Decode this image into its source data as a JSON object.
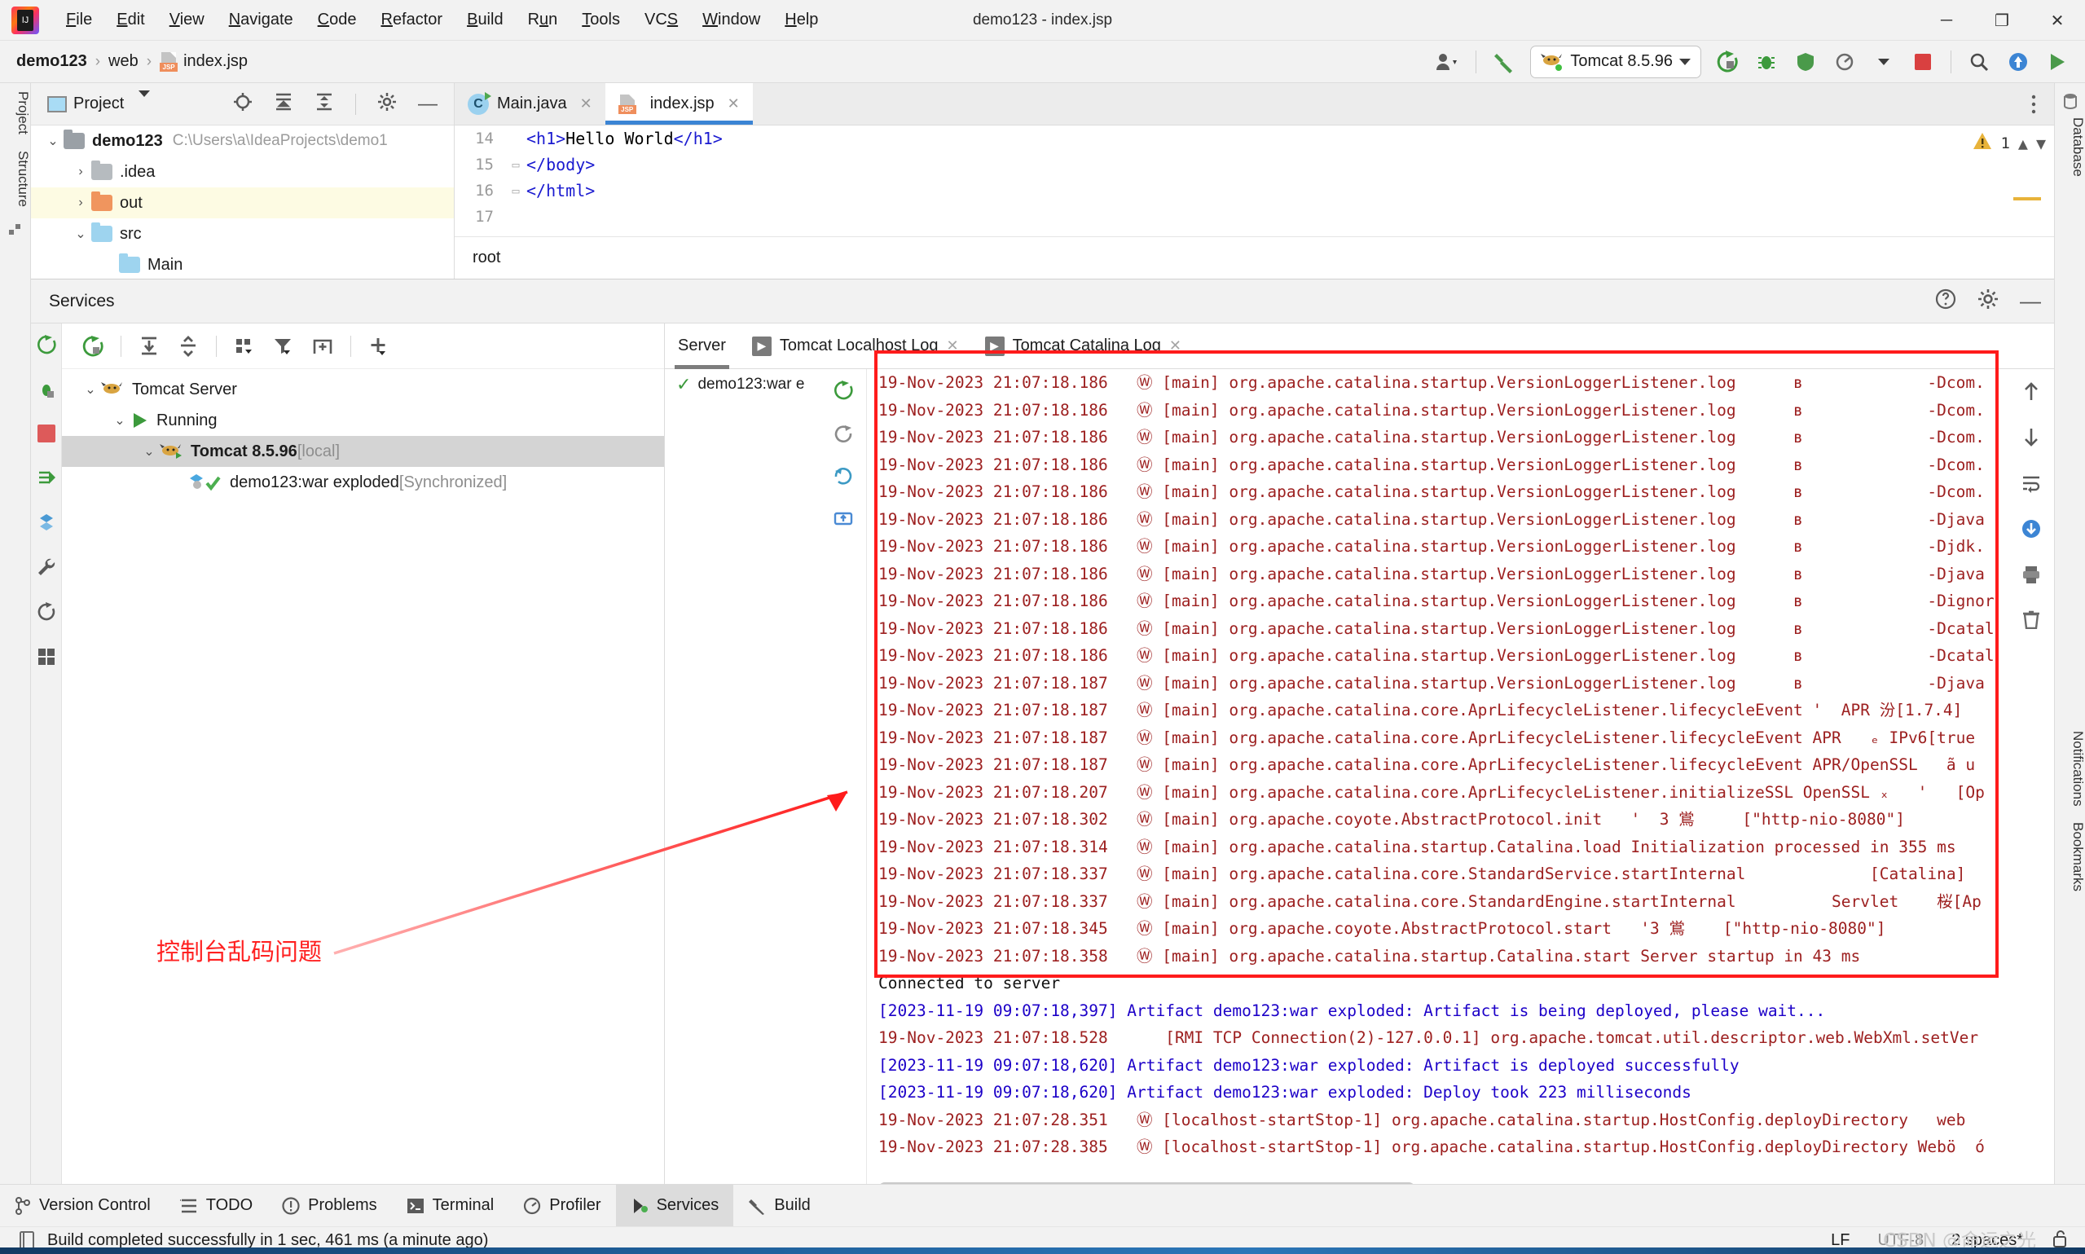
{
  "window": {
    "title": "demo123 - index.jsp",
    "minimize": "─",
    "maximize": "❐",
    "close": "✕"
  },
  "menubar": [
    {
      "label": "File",
      "mnemonic": "F"
    },
    {
      "label": "Edit",
      "mnemonic": "E"
    },
    {
      "label": "View",
      "mnemonic": "V"
    },
    {
      "label": "Navigate",
      "mnemonic": "N"
    },
    {
      "label": "Code",
      "mnemonic": "C"
    },
    {
      "label": "Refactor",
      "mnemonic": "R"
    },
    {
      "label": "Build",
      "mnemonic": "B"
    },
    {
      "label": "Run",
      "mnemonic": "u"
    },
    {
      "label": "Tools",
      "mnemonic": "T"
    },
    {
      "label": "VCS",
      "mnemonic": "S"
    },
    {
      "label": "Window",
      "mnemonic": "W"
    },
    {
      "label": "Help",
      "mnemonic": "H"
    }
  ],
  "toolbar": {
    "breadcrumbs": [
      "demo123",
      "web",
      "index.jsp"
    ],
    "separator": "›",
    "run_config": "Tomcat 8.5.96",
    "icons": [
      "account-icon",
      "build-hammer-icon",
      "tomcat-icon",
      "rerun-icon",
      "debug-icon",
      "coverage-icon",
      "profiler-icon",
      "stop-icon",
      "search-icon",
      "updates-icon",
      "run-icon"
    ]
  },
  "left_rail": [
    "Project",
    "Structure"
  ],
  "right_rail": [
    "Database",
    "Notifications",
    "Bookmarks"
  ],
  "project_panel": {
    "title": "Project",
    "tree": [
      {
        "label": "demo123",
        "note": "C:\\Users\\a\\IdeaProjects\\demo1",
        "chevron": "⌄",
        "color": "#9aa0a6",
        "bold": true,
        "indent": 0,
        "highlight": false
      },
      {
        "label": ".idea",
        "note": "",
        "chevron": "›",
        "color": "#b6bbbf",
        "bold": false,
        "indent": 1,
        "highlight": false
      },
      {
        "label": "out",
        "note": "",
        "chevron": "›",
        "color": "#f0955e",
        "bold": false,
        "indent": 1,
        "highlight": true
      },
      {
        "label": "src",
        "note": "",
        "chevron": "⌄",
        "color": "#9ed4ef",
        "bold": false,
        "indent": 1,
        "highlight": false
      },
      {
        "label": "Main",
        "note": "",
        "chevron": "",
        "color": "#9ed4ef",
        "bold": false,
        "indent": 2,
        "highlight": false
      }
    ]
  },
  "editor": {
    "tabs": [
      {
        "label": "Main.java",
        "icon": "java-class-icon",
        "active": false,
        "close": "✕"
      },
      {
        "label": "index.jsp",
        "icon": "jsp-file-icon",
        "active": true,
        "close": "✕"
      }
    ],
    "warning_count": "1",
    "lines": [
      {
        "num": "14",
        "fold": "",
        "indent": "    ",
        "code": "<h1>Hello World</h1>"
      },
      {
        "num": "15",
        "fold": "▭",
        "indent": "    ",
        "code": "</body>"
      },
      {
        "num": "16",
        "fold": "▭",
        "indent": "",
        "code": "</html>"
      },
      {
        "num": "17",
        "fold": "",
        "indent": "",
        "code": ""
      }
    ],
    "breadcrumb_bottom": "root"
  },
  "services": {
    "title": "Services",
    "toolbar_icons": [
      "rerun-icon",
      "expand-all-icon",
      "collapse-all-icon",
      "group-icon",
      "filter-icon",
      "add-tab-icon",
      "add-icon"
    ],
    "header_right_icons": [
      "help-icon",
      "gear-icon",
      "minimize-icon"
    ],
    "rail_icons": [
      "rerun-icon",
      "debug-icon",
      "stop-icon",
      "redeploy-icon",
      "artifacts-icon",
      "settings-wrench-icon",
      "refresh-icon",
      "layout-icon"
    ],
    "tree": [
      {
        "label": "Tomcat Server",
        "note": "",
        "icon": "tomcat-icon",
        "chevron": "⌄",
        "indent": 0,
        "bold": false,
        "selected": false
      },
      {
        "label": "Running",
        "note": "",
        "icon": "run-triangle-icon",
        "chevron": "⌄",
        "indent": 1,
        "bold": false,
        "selected": false
      },
      {
        "label": "Tomcat 8.5.96",
        "note": "[local]",
        "icon": "tomcat-run-icon",
        "chevron": "⌄",
        "indent": 2,
        "bold": true,
        "selected": true
      },
      {
        "label": "demo123:war exploded",
        "note": "[Synchronized]",
        "icon": "artifact-ok-icon",
        "chevron": "",
        "indent": 3,
        "bold": false,
        "selected": false
      }
    ],
    "log_tabs": [
      {
        "label": "Server",
        "icon": "",
        "active": true,
        "closable": false
      },
      {
        "label": "Tomcat Localhost Log",
        "icon": "log-icon",
        "active": false,
        "closable": true
      },
      {
        "label": "Tomcat Catalina Log",
        "icon": "log-icon",
        "active": false,
        "closable": true
      }
    ],
    "deployment": {
      "item": "demo123:war e",
      "status_icon": "check-icon",
      "toolbar_icons": [
        "rerun-icon",
        "undeploy-icon",
        "redeploy-icon",
        "update-icon"
      ]
    },
    "console_rail_icons": [
      "scroll-up-icon",
      "scroll-down-icon",
      "soft-wrap-icon",
      "scroll-to-end-icon",
      "print-icon",
      "trash-icon"
    ]
  },
  "console_lines": [
    {
      "color": "red",
      "text": "19-Nov-2023 21:07:18.186   Ⓦ [main] org.apache.catalina.startup.VersionLoggerListener.log      в             -Dcom."
    },
    {
      "color": "red",
      "text": "19-Nov-2023 21:07:18.186   Ⓦ [main] org.apache.catalina.startup.VersionLoggerListener.log      в             -Dcom."
    },
    {
      "color": "red",
      "text": "19-Nov-2023 21:07:18.186   Ⓦ [main] org.apache.catalina.startup.VersionLoggerListener.log      в             -Dcom."
    },
    {
      "color": "red",
      "text": "19-Nov-2023 21:07:18.186   Ⓦ [main] org.apache.catalina.startup.VersionLoggerListener.log      в             -Dcom."
    },
    {
      "color": "red",
      "text": "19-Nov-2023 21:07:18.186   Ⓦ [main] org.apache.catalina.startup.VersionLoggerListener.log      в             -Dcom."
    },
    {
      "color": "red",
      "text": "19-Nov-2023 21:07:18.186   Ⓦ [main] org.apache.catalina.startup.VersionLoggerListener.log      в             -Djava"
    },
    {
      "color": "red",
      "text": "19-Nov-2023 21:07:18.186   Ⓦ [main] org.apache.catalina.startup.VersionLoggerListener.log      в             -Djdk."
    },
    {
      "color": "red",
      "text": "19-Nov-2023 21:07:18.186   Ⓦ [main] org.apache.catalina.startup.VersionLoggerListener.log      в             -Djava"
    },
    {
      "color": "red",
      "text": "19-Nov-2023 21:07:18.186   Ⓦ [main] org.apache.catalina.startup.VersionLoggerListener.log      в             -Dignor"
    },
    {
      "color": "red",
      "text": "19-Nov-2023 21:07:18.186   Ⓦ [main] org.apache.catalina.startup.VersionLoggerListener.log      в             -Dcatal"
    },
    {
      "color": "red",
      "text": "19-Nov-2023 21:07:18.186   Ⓦ [main] org.apache.catalina.startup.VersionLoggerListener.log      в             -Dcatal"
    },
    {
      "color": "red",
      "text": "19-Nov-2023 21:07:18.187   Ⓦ [main] org.apache.catalina.startup.VersionLoggerListener.log      в             -Djava"
    },
    {
      "color": "red",
      "text": "19-Nov-2023 21:07:18.187   Ⓦ [main] org.apache.catalina.core.AprLifecycleListener.lifecycleEvent '  APR 汾[1.7.4]  "
    },
    {
      "color": "red",
      "text": "19-Nov-2023 21:07:18.187   Ⓦ [main] org.apache.catalina.core.AprLifecycleListener.lifecycleEvent APR   ₑ IPv6[true"
    },
    {
      "color": "red",
      "text": "19-Nov-2023 21:07:18.187   Ⓦ [main] org.apache.catalina.core.AprLifecycleListener.lifecycleEvent APR/OpenSSL   ã u"
    },
    {
      "color": "red",
      "text": "19-Nov-2023 21:07:18.207   Ⓦ [main] org.apache.catalina.core.AprLifecycleListener.initializeSSL OpenSSL ₓ   '   [Op"
    },
    {
      "color": "red",
      "text": "19-Nov-2023 21:07:18.302   Ⓦ [main] org.apache.coyote.AbstractProtocol.init   '  3 鴬     [\"http-nio-8080\"]"
    },
    {
      "color": "red",
      "text": "19-Nov-2023 21:07:18.314   Ⓦ [main] org.apache.catalina.startup.Catalina.load Initialization processed in 355 ms"
    },
    {
      "color": "red",
      "text": "19-Nov-2023 21:07:18.337   Ⓦ [main] org.apache.catalina.core.StandardService.startInternal             [Catalina]"
    },
    {
      "color": "red",
      "text": "19-Nov-2023 21:07:18.337   Ⓦ [main] org.apache.catalina.core.StandardEngine.startInternal          Servlet    桜[Ap"
    },
    {
      "color": "red",
      "text": "19-Nov-2023 21:07:18.345   Ⓦ [main] org.apache.coyote.AbstractProtocol.start   '3 鴬    [\"http-nio-8080\"]"
    },
    {
      "color": "red",
      "text": "19-Nov-2023 21:07:18.358   Ⓦ [main] org.apache.catalina.startup.Catalina.start Server startup in 43 ms"
    },
    {
      "color": "black",
      "text": "Connected to server"
    },
    {
      "color": "blue",
      "text": "[2023-11-19 09:07:18,397] Artifact demo123:war exploded: Artifact is being deployed, please wait..."
    },
    {
      "color": "red",
      "text": "19-Nov-2023 21:07:18.528      [RMI TCP Connection(2)-127.0.0.1] org.apache.tomcat.util.descriptor.web.WebXml.setVer"
    },
    {
      "color": "blue",
      "text": "[2023-11-19 09:07:18,620] Artifact demo123:war exploded: Artifact is deployed successfully"
    },
    {
      "color": "blue",
      "text": "[2023-11-19 09:07:18,620] Artifact demo123:war exploded: Deploy took 223 milliseconds"
    },
    {
      "color": "red",
      "text": "19-Nov-2023 21:07:28.351   Ⓦ [localhost-startStop-1] org.apache.catalina.startup.HostConfig.deployDirectory   web  "
    },
    {
      "color": "red",
      "text": "19-Nov-2023 21:07:28.385   Ⓦ [localhost-startStop-1] org.apache.catalina.startup.HostConfig.deployDirectory Webö  ó"
    }
  ],
  "annotation": {
    "text": "控制台乱码问题",
    "color": "#ff2020"
  },
  "bottom_bar": [
    {
      "label": "Version Control",
      "icon": "branch-icon",
      "active": false
    },
    {
      "label": "TODO",
      "icon": "list-icon",
      "active": false
    },
    {
      "label": "Problems",
      "icon": "problems-icon",
      "active": false
    },
    {
      "label": "Terminal",
      "icon": "terminal-icon",
      "active": false
    },
    {
      "label": "Profiler",
      "icon": "profiler-icon",
      "active": false
    },
    {
      "label": "Services",
      "icon": "services-icon",
      "active": true
    },
    {
      "label": "Build",
      "icon": "build-icon",
      "active": false
    }
  ],
  "statusbar": {
    "message": "Build completed successfully in 1 sec, 461 ms (a minute ago)",
    "icon": "build-log-icon",
    "line_sep": "LF",
    "encoding": "UTF-8",
    "indent": "2 spaces*",
    "lock_icon": "unlocked-icon",
    "watermark": "CSDN @命运之光"
  },
  "colors": {
    "accent_blue": "#3b84d4",
    "log_red": "#9d2020",
    "log_blue": "#1c00c8",
    "annotation_red": "#ff1b1b",
    "tomcat_green": "#3c9a3c"
  }
}
